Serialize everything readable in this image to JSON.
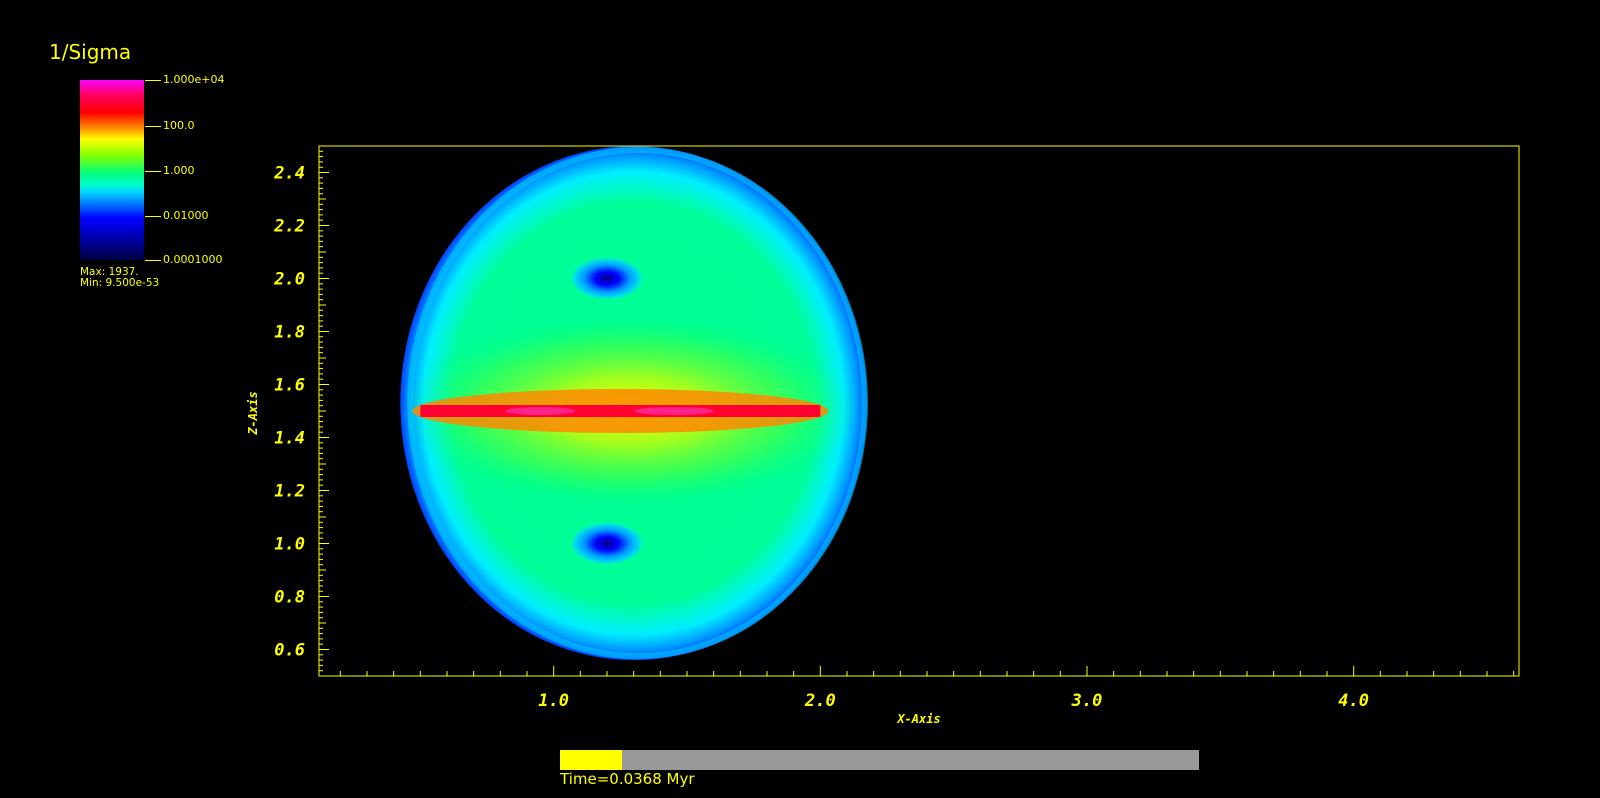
{
  "legend": {
    "title": "1/Sigma",
    "ticks": [
      "1.000e+04",
      "100.0",
      "1.000",
      "0.01000",
      "0.0001000"
    ],
    "max_label": "Max:  1937.",
    "min_label": "Min:  9.500e-53"
  },
  "chart_data": {
    "type": "heatmap",
    "title": "1/Sigma",
    "xlabel": "X-Axis",
    "ylabel": "Z-Axis",
    "xlim": [
      0.12,
      4.62
    ],
    "ylim": [
      0.5,
      2.5
    ],
    "x_ticks": [
      1.0,
      2.0,
      3.0,
      4.0
    ],
    "x_tick_labels": [
      "1.0",
      "2.0",
      "3.0",
      "4.0"
    ],
    "y_ticks": [
      0.6,
      0.8,
      1.0,
      1.2,
      1.4,
      1.6,
      1.8,
      2.0,
      2.2,
      2.4
    ],
    "y_tick_labels": [
      "0.6",
      "0.8",
      "1.0",
      "1.2",
      "1.4",
      "1.6",
      "1.8",
      "2.0",
      "2.2",
      "2.4"
    ],
    "color_scale": "log",
    "color_range": [
      0.0001,
      10000
    ],
    "features": {
      "bubble": {
        "center_x": 1.3,
        "center_z": 1.53,
        "x_extent": [
          0.45,
          2.2
        ],
        "z_extent": [
          0.53,
          2.47
        ],
        "value": 1.0
      },
      "jet": {
        "x_range": [
          0.5,
          2.0
        ],
        "z": 1.5,
        "value": 1000
      },
      "cavities": [
        {
          "x": 1.2,
          "z": 2.0,
          "value": 0.001
        },
        {
          "x": 1.2,
          "z": 1.0,
          "value": 0.001
        }
      ]
    }
  },
  "progress": {
    "fraction": 0.097,
    "label": "Time=0.0368 Myr"
  },
  "colors": {
    "accent": "#ffff00",
    "background": "#000000",
    "track": "#999999"
  }
}
